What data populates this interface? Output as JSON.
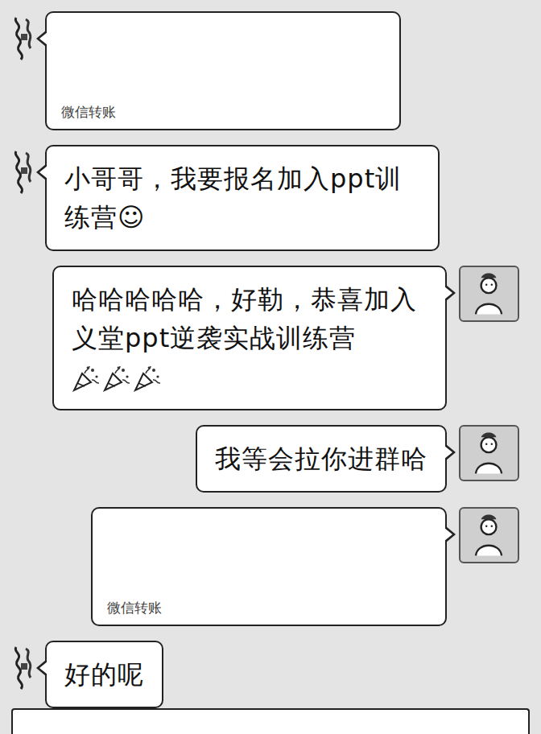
{
  "messages": [
    {
      "side": "left",
      "kind": "transfer",
      "label": "微信转账"
    },
    {
      "side": "left",
      "kind": "text",
      "text": "小哥哥，我要报名加入ppt训练营☺",
      "poppers": 0
    },
    {
      "side": "right",
      "kind": "text",
      "text": "哈哈哈哈哈，好勒，恭喜加入义堂ppt逆袭实战训练营",
      "poppers": 3
    },
    {
      "side": "right",
      "kind": "text",
      "text": "我等会拉你进群哈",
      "poppers": 0
    },
    {
      "side": "right",
      "kind": "transfer",
      "label": "微信转账"
    },
    {
      "side": "left",
      "kind": "text",
      "text": "好的呢",
      "poppers": 0
    }
  ]
}
